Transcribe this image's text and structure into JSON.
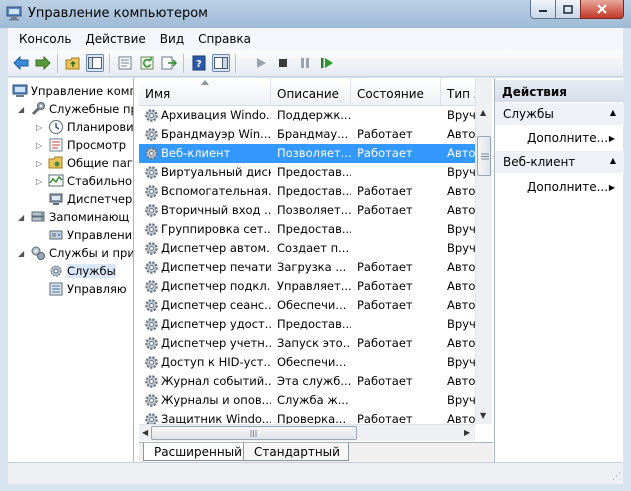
{
  "window": {
    "title": "Управление компьютером"
  },
  "menu": [
    "Консоль",
    "Действие",
    "Вид",
    "Справка"
  ],
  "tree": [
    {
      "label": "Управление комп",
      "icon": "computer-management-icon",
      "level": 0,
      "expanded": true
    },
    {
      "label": "Служебные пр",
      "icon": "tools-icon",
      "level": 1,
      "expanded": true
    },
    {
      "label": "Планирови",
      "icon": "task-scheduler-icon",
      "level": 2,
      "collapsed": true
    },
    {
      "label": "Просмотр",
      "icon": "event-viewer-icon",
      "level": 2,
      "collapsed": true
    },
    {
      "label": "Общие паг",
      "icon": "shared-folders-icon",
      "level": 2,
      "collapsed": true
    },
    {
      "label": "Стабильно",
      "icon": "reliability-icon",
      "level": 2,
      "collapsed": true
    },
    {
      "label": "Диспетчер",
      "icon": "device-manager-icon",
      "level": 2
    },
    {
      "label": "Запоминающ",
      "icon": "storage-icon",
      "level": 1,
      "expanded": true
    },
    {
      "label": "Управлени",
      "icon": "disk-management-icon",
      "level": 2
    },
    {
      "label": "Службы и при",
      "icon": "services-apps-icon",
      "level": 1,
      "expanded": true
    },
    {
      "label": "Службы",
      "icon": "services-icon",
      "level": 2,
      "selected": true
    },
    {
      "label": "Управляю",
      "icon": "wmi-control-icon",
      "level": 2
    }
  ],
  "columns": [
    "Имя",
    "Описание",
    "Состояние",
    "Тип з"
  ],
  "services": [
    {
      "name": "Архивация Windo...",
      "desc": "Поддержк...",
      "state": "",
      "type": "Вруч"
    },
    {
      "name": "Брандмауэр Win...",
      "desc": "Брандмау...",
      "state": "Работает",
      "type": "Авто"
    },
    {
      "name": "Веб-клиент",
      "desc": "Позволяет...",
      "state": "Работает",
      "type": "Авто",
      "selected": true
    },
    {
      "name": "Виртуальный диск",
      "desc": "Предостав...",
      "state": "",
      "type": "Вруч"
    },
    {
      "name": "Вспомогательная...",
      "desc": "Предостав...",
      "state": "Работает",
      "type": "Авто"
    },
    {
      "name": "Вторичный вход ...",
      "desc": "Позволяет...",
      "state": "Работает",
      "type": "Авто"
    },
    {
      "name": "Группировка сет...",
      "desc": "Предостав...",
      "state": "",
      "type": "Вруч"
    },
    {
      "name": "Диспетчер автом...",
      "desc": "Создает п...",
      "state": "",
      "type": "Вруч"
    },
    {
      "name": "Диспетчер печати",
      "desc": "Загрузка ...",
      "state": "Работает",
      "type": "Авто"
    },
    {
      "name": "Диспетчер подкл...",
      "desc": "Управляет...",
      "state": "Работает",
      "type": "Авто"
    },
    {
      "name": "Диспетчер сеанс...",
      "desc": "Обеспечи...",
      "state": "Работает",
      "type": "Авто"
    },
    {
      "name": "Диспетчер удост...",
      "desc": "Предостав...",
      "state": "",
      "type": "Вруч"
    },
    {
      "name": "Диспетчер учетн...",
      "desc": "Запуск это...",
      "state": "Работает",
      "type": "Авто"
    },
    {
      "name": "Доступ к HID-уст...",
      "desc": "Обеспечи...",
      "state": "",
      "type": "Вруч"
    },
    {
      "name": "Журнал событий...",
      "desc": "Эта служб...",
      "state": "Работает",
      "type": "Авто"
    },
    {
      "name": "Журналы и опов...",
      "desc": "Служба ж...",
      "state": "",
      "type": "Вруч"
    },
    {
      "name": "Защитник Windo...",
      "desc": "Проверка...",
      "state": "Работает",
      "type": "Авто"
    }
  ],
  "view_tabs": [
    "Расширенный",
    "Стандартный"
  ],
  "actions": {
    "header": "Действия",
    "sections": [
      {
        "title": "Службы",
        "items": [
          "Дополните..."
        ]
      },
      {
        "title": "Веб-клиент",
        "items": [
          "Дополните..."
        ]
      }
    ]
  },
  "colors": {
    "selection": "#3399ff",
    "titlebar": "#b3c9e0",
    "close_button": "#c84030"
  }
}
